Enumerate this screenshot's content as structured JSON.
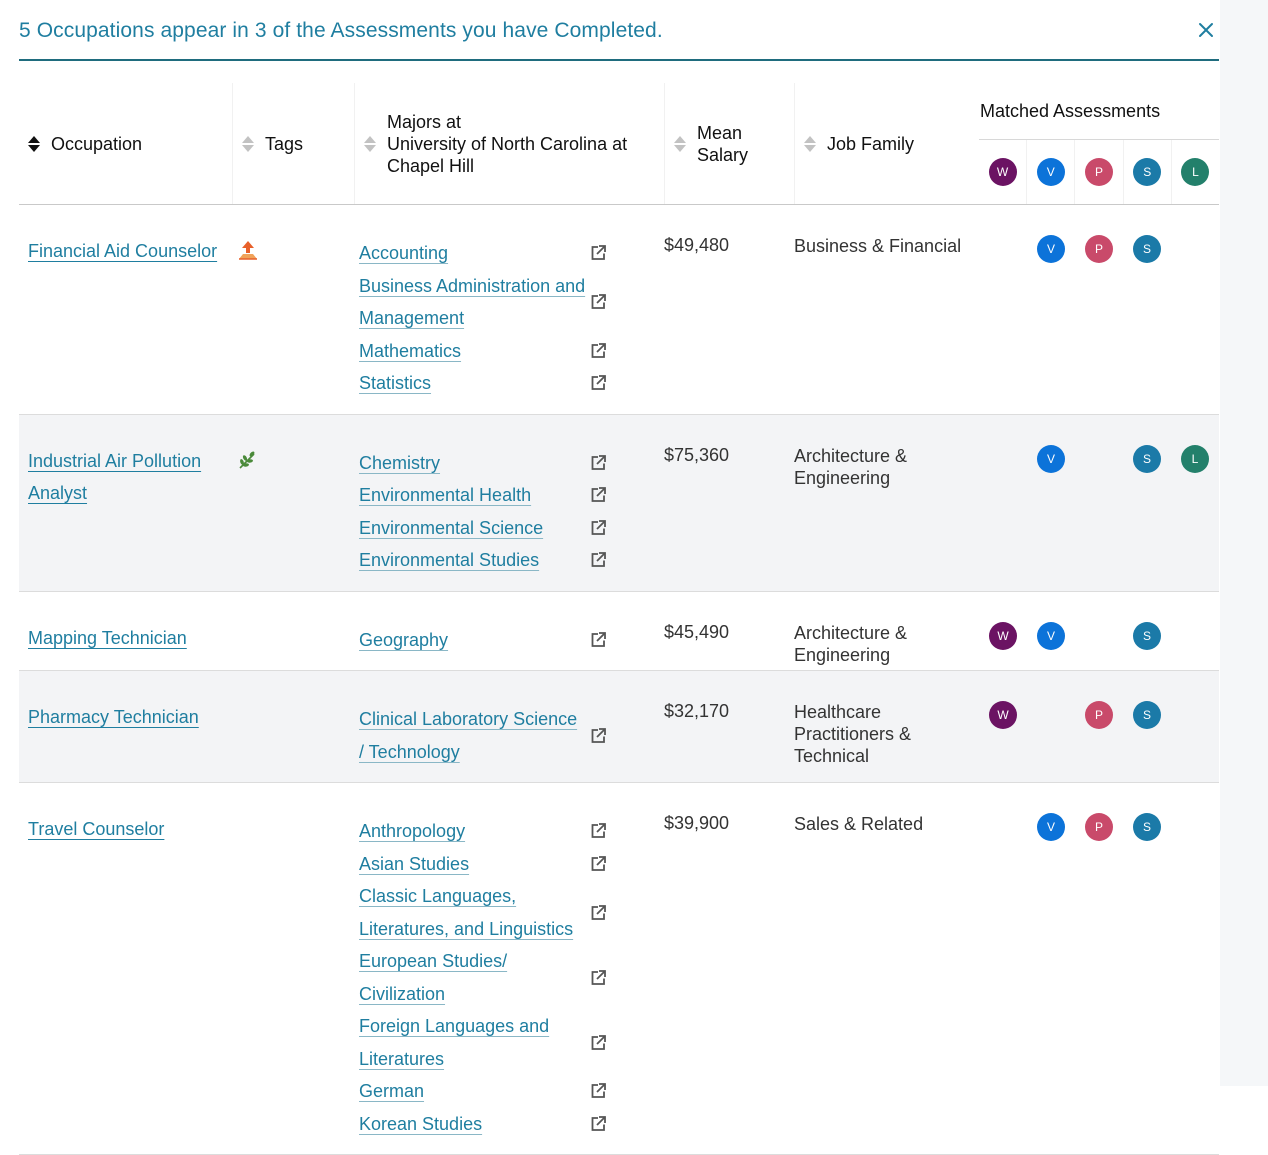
{
  "header": {
    "title": "5 Occupations appear in 3 of the Assessments you have Completed."
  },
  "columns": {
    "occupation": "Occupation",
    "tags": "Tags",
    "majors_line1": "Majors at",
    "majors_line2": "University of North Carolina at",
    "majors_line3": "Chapel Hill",
    "salary_line1": "Mean",
    "salary_line2": "Salary",
    "job_family": "Job Family",
    "matched": "Matched Assessments"
  },
  "assessments": [
    "W",
    "V",
    "P",
    "S",
    "L"
  ],
  "colors": {
    "accent": "#1f7ea0",
    "W": "#6b1363",
    "V": "#0c73d9",
    "P": "#c94a6a",
    "S": "#1b7aa8",
    "L": "#23806b"
  },
  "rows": [
    {
      "occupation": "Financial Aid Counselor",
      "tag_icon": "growth-arrow-icon",
      "majors": [
        "Accounting",
        "Business Administration and Management",
        "Mathematics",
        "Statistics"
      ],
      "salary": "$49,480",
      "job_family": "Business & Financial",
      "matched": [
        "V",
        "P",
        "S"
      ]
    },
    {
      "occupation": "Industrial Air Pollution Analyst",
      "tag_icon": "green-leaf-icon",
      "majors": [
        "Chemistry",
        "Environmental Health",
        "Environmental Science",
        "Environmental Studies"
      ],
      "salary": "$75,360",
      "job_family": "Architecture & Engineering",
      "matched": [
        "V",
        "S",
        "L"
      ]
    },
    {
      "occupation": "Mapping Technician",
      "tag_icon": "",
      "majors": [
        "Geography"
      ],
      "salary": "$45,490",
      "job_family": "Architecture & Engineering",
      "matched": [
        "W",
        "V",
        "S"
      ]
    },
    {
      "occupation": "Pharmacy Technician",
      "tag_icon": "",
      "majors": [
        "Clinical Laboratory Science / Technology"
      ],
      "salary": "$32,170",
      "job_family": "Healthcare Practitioners & Technical",
      "matched": [
        "W",
        "P",
        "S"
      ]
    },
    {
      "occupation": "Travel Counselor",
      "tag_icon": "",
      "majors": [
        "Anthropology",
        "Asian Studies",
        "Classic Languages, Literatures, and Linguistics",
        "European Studies/ Civilization",
        "Foreign Languages and Literatures",
        "German",
        "Korean Studies"
      ],
      "salary": "$39,900",
      "job_family": "Sales & Related",
      "matched": [
        "V",
        "P",
        "S"
      ]
    }
  ]
}
